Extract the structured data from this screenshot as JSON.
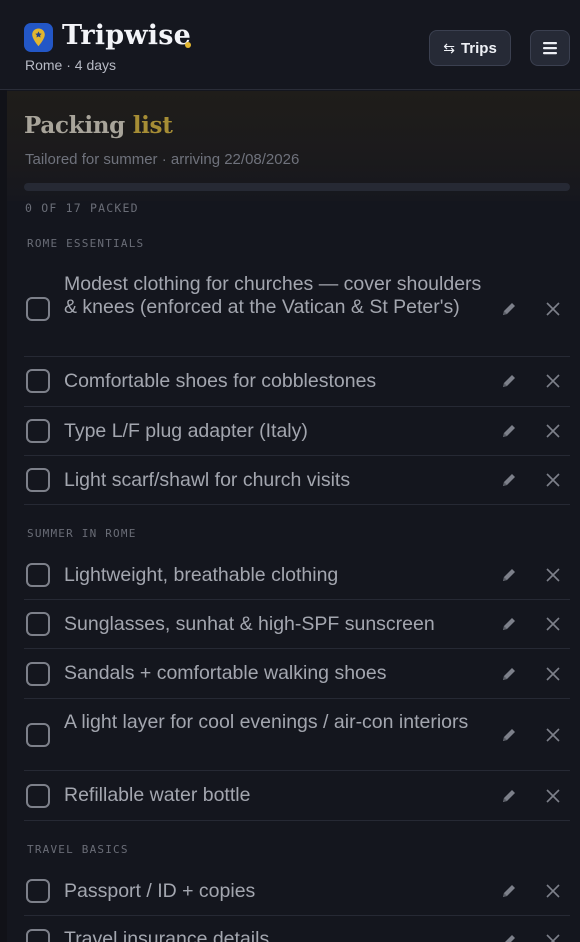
{
  "header": {
    "app_name": "Tripwise",
    "subtitle": "Rome · 4 days",
    "trips_label": "Trips",
    "trips_icon": "swap-arrows-icon",
    "menu_icon": "hamburger-menu-icon",
    "brand_color": "#e2b630",
    "logo_color": "#2357c6"
  },
  "packing": {
    "title_main": "Packing",
    "title_accent": "list",
    "tailored": "Tailored for summer · arriving 22/08/2026",
    "progress_fraction": 0,
    "count_label": "0 OF 17 PACKED"
  },
  "sections": [
    {
      "label": "ROME ESSENTIALS",
      "items": [
        {
          "text": "Modest clothing for churches — cover shoulders & knees (enforced at the Vatican & St Peter's)",
          "checked": false
        },
        {
          "text": "Comfortable shoes for cobblestones",
          "checked": false
        },
        {
          "text": "Type L/F plug adapter (Italy)",
          "checked": false
        },
        {
          "text": "Light scarf/shawl for church visits",
          "checked": false
        }
      ]
    },
    {
      "label": "SUMMER IN ROME",
      "items": [
        {
          "text": "Lightweight, breathable clothing",
          "checked": false
        },
        {
          "text": "Sunglasses, sunhat & high-SPF sunscreen",
          "checked": false
        },
        {
          "text": "Sandals + comfortable walking shoes",
          "checked": false
        },
        {
          "text": "A light layer for cool evenings / air-con interiors",
          "checked": false
        },
        {
          "text": "Refillable water bottle",
          "checked": false
        }
      ]
    },
    {
      "label": "TRAVEL BASICS",
      "items": [
        {
          "text": "Passport / ID + copies",
          "checked": false
        },
        {
          "text": "Travel insurance details",
          "checked": false
        }
      ]
    }
  ]
}
